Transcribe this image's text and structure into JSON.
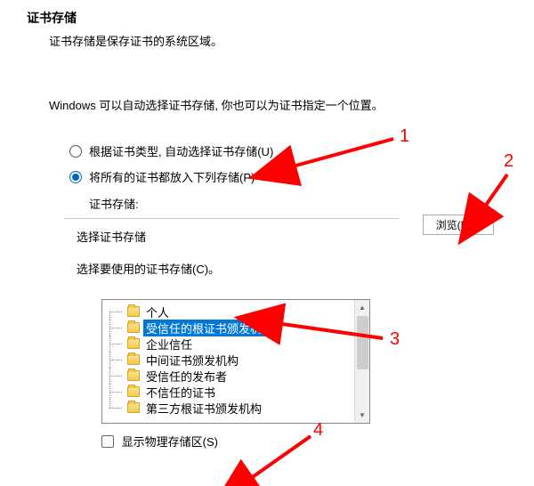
{
  "page": {
    "title": "证书存储",
    "subtitle": "证书存储是保存证书的系统区域。",
    "instruction": "Windows 可以自动选择证书存储, 你也可以为证书指定一个位置。"
  },
  "radios": {
    "auto": "根据证书类型, 自动选择证书存储(U)",
    "place": "将所有的证书都放入下列存储(P)",
    "store_label": "证书存储:"
  },
  "browse_btn": "浏览(R)...",
  "dialog": {
    "title": "选择证书存储",
    "instr": "选择要使用的证书存储(C)。",
    "show_physical": "显示物理存储区(S)",
    "tree": [
      "个人",
      "受信任的根证书颁发机构",
      "企业信任",
      "中间证书颁发机构",
      "受信任的发布者",
      "不信任的证书",
      "第三方根证书颁发机构"
    ],
    "selected_index": 1
  },
  "annotations": {
    "n1": "1",
    "n2": "2",
    "n3": "3",
    "n4": "4"
  }
}
